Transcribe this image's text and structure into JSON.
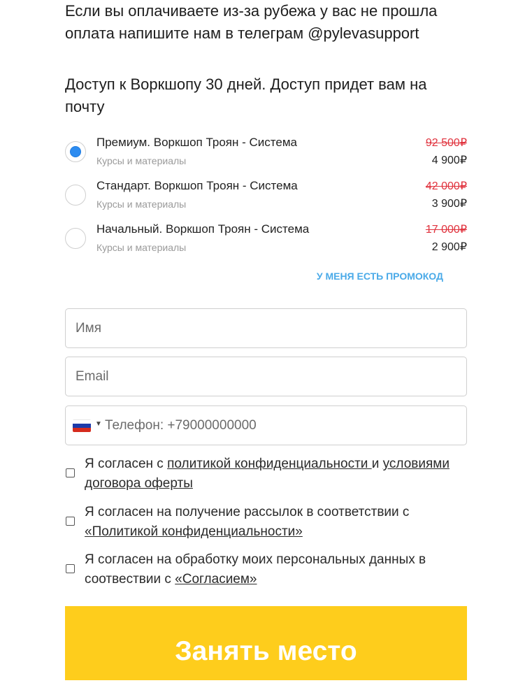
{
  "intro_text": "Если вы оплачиваете из-за рубежа у вас не прошла оплата напишите нам в телеграм @pylevasupport",
  "access_text": "Доступ к Воркшопу 30 дней. Доступ придет вам на почту",
  "plans": [
    {
      "title": "Премиум. Воркшоп Троян - Система",
      "subtitle": "Курсы и материалы",
      "old_price": "92 500₽",
      "price": "4 900₽",
      "selected": true
    },
    {
      "title": "Стандарт. Воркшоп Троян - Система",
      "subtitle": "Курсы и материалы",
      "old_price": "42 000₽",
      "price": "3 900₽",
      "selected": false
    },
    {
      "title": "Начальный. Воркшоп Троян - Система",
      "subtitle": "Курсы и материалы",
      "old_price": "17 000₽",
      "price": "2 900₽",
      "selected": false
    }
  ],
  "promo_label": "У меня есть промокод",
  "form": {
    "name_placeholder": "Имя",
    "email_placeholder": "Email",
    "phone_placeholder": "Телефон: +79000000000",
    "phone_country_icon": "russia-flag-icon"
  },
  "consents": {
    "privacy": {
      "prefix": "Я согласен с ",
      "link1": "политикой конфиденциальности ",
      "middle": "и ",
      "link2": "условиями договора оферты"
    },
    "mailing": {
      "prefix": "Я согласен на получение рассылок в соответствии с ",
      "link": "«Политикой конфиденциальности»"
    },
    "personal_data": {
      "prefix": "Я согласен на обработку моих персональных данных в соотвествии с ",
      "link": "«Согласием»"
    }
  },
  "submit_label": "Занять место",
  "colors": {
    "accent_yellow": "#fecd1c",
    "radio_blue": "#2d8cf0",
    "promo_blue": "#4aaae8",
    "old_price_red": "#e0323d"
  }
}
